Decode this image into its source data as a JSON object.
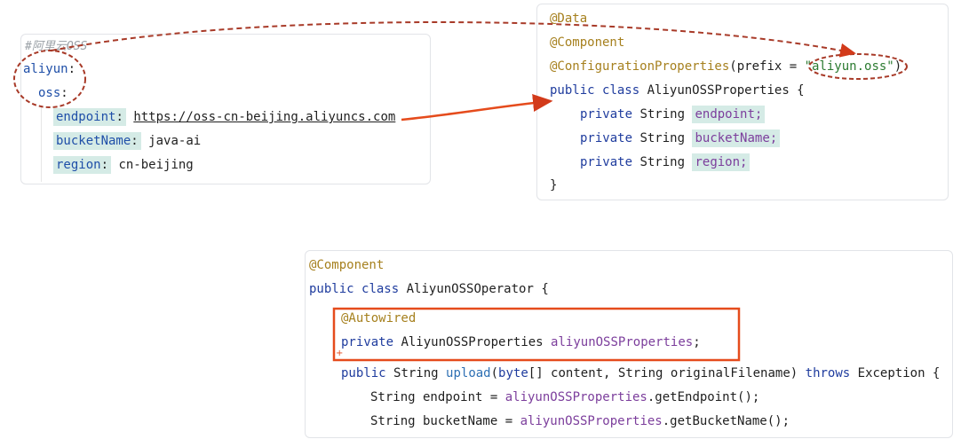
{
  "yaml": {
    "comment": "#阿里云OSS",
    "aliyun_key": "aliyun",
    "oss_key": "oss",
    "endpoint_key": "endpoint",
    "endpoint_value": "https://oss-cn-beijing.aliyuncs.com",
    "bucket_key": "bucketName",
    "bucket_value": "java-ai",
    "region_key": "region",
    "region_value": "cn-beijing",
    "colon": ":"
  },
  "properties_class": {
    "ann_data": "@Data",
    "ann_component": "@Component",
    "ann_config": "@ConfigurationProperties",
    "prefix_open": "(prefix = ",
    "prefix_value": "\"aliyun.oss\"",
    "prefix_close": ")",
    "kw_public": "public",
    "kw_class": "class",
    "class_name": "AliyunOSSProperties {",
    "kw_private": "private",
    "type_string": "String",
    "field_endpoint": "endpoint;",
    "field_bucket": "bucketName;",
    "field_region": "region;",
    "close_brace": "}"
  },
  "operator_class": {
    "ann_component": "@Component",
    "kw_public": "public",
    "kw_class": "class",
    "class_name": "AliyunOSSOperator {",
    "ann_autowired": "@Autowired",
    "kw_private": "private",
    "props_type": "AliyunOSSProperties",
    "props_field": "aliyunOSSProperties",
    "semicolon": ";",
    "type_string": "String",
    "method_name": "upload",
    "paren_open": "(",
    "kw_byte": "byte",
    "params_rest": "[] content, String originalFilename) ",
    "kw_throws": "throws",
    "exception_rest": " Exception {",
    "endpoint_decl": "String endpoint = ",
    "endpoint_call": ".getEndpoint();",
    "bucket_decl": "String bucketName = ",
    "bucket_call": ".getBucketName();"
  },
  "colors": {
    "annotation_red": "#d23a1a",
    "highlight": "#d5ebe6",
    "annotation_yellow": "#a6801e",
    "keyword_blue": "#1f3c9e",
    "field_purple": "#7c3e9c"
  }
}
